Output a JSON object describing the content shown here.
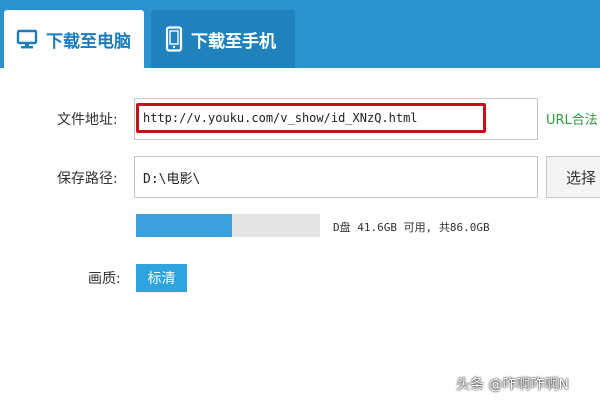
{
  "tabs": [
    {
      "label": "下载至电脑",
      "icon": "monitor-icon",
      "active": true
    },
    {
      "label": "下载至手机",
      "icon": "phone-icon",
      "active": false
    }
  ],
  "form": {
    "url_label": "文件地址:",
    "url_value": "http://v.youku.com/v_show/id_XNzQ.html",
    "url_status": "URL合法",
    "path_label": "保存路径:",
    "path_value": "D:\\电影\\",
    "choose_label": "选择",
    "disk_usage_fraction": 0.52,
    "disk_text": "D盘 41.6GB 可用, 共86.0GB",
    "quality_label": "画质:",
    "quality_value": "标清"
  },
  "watermark": "头条 @咋啊咋啊N",
  "colors": {
    "header_blue": "#2a93cf",
    "accent_blue": "#3aa1dc",
    "highlight_red": "#c4121a",
    "valid_green": "#2e9b3a"
  }
}
